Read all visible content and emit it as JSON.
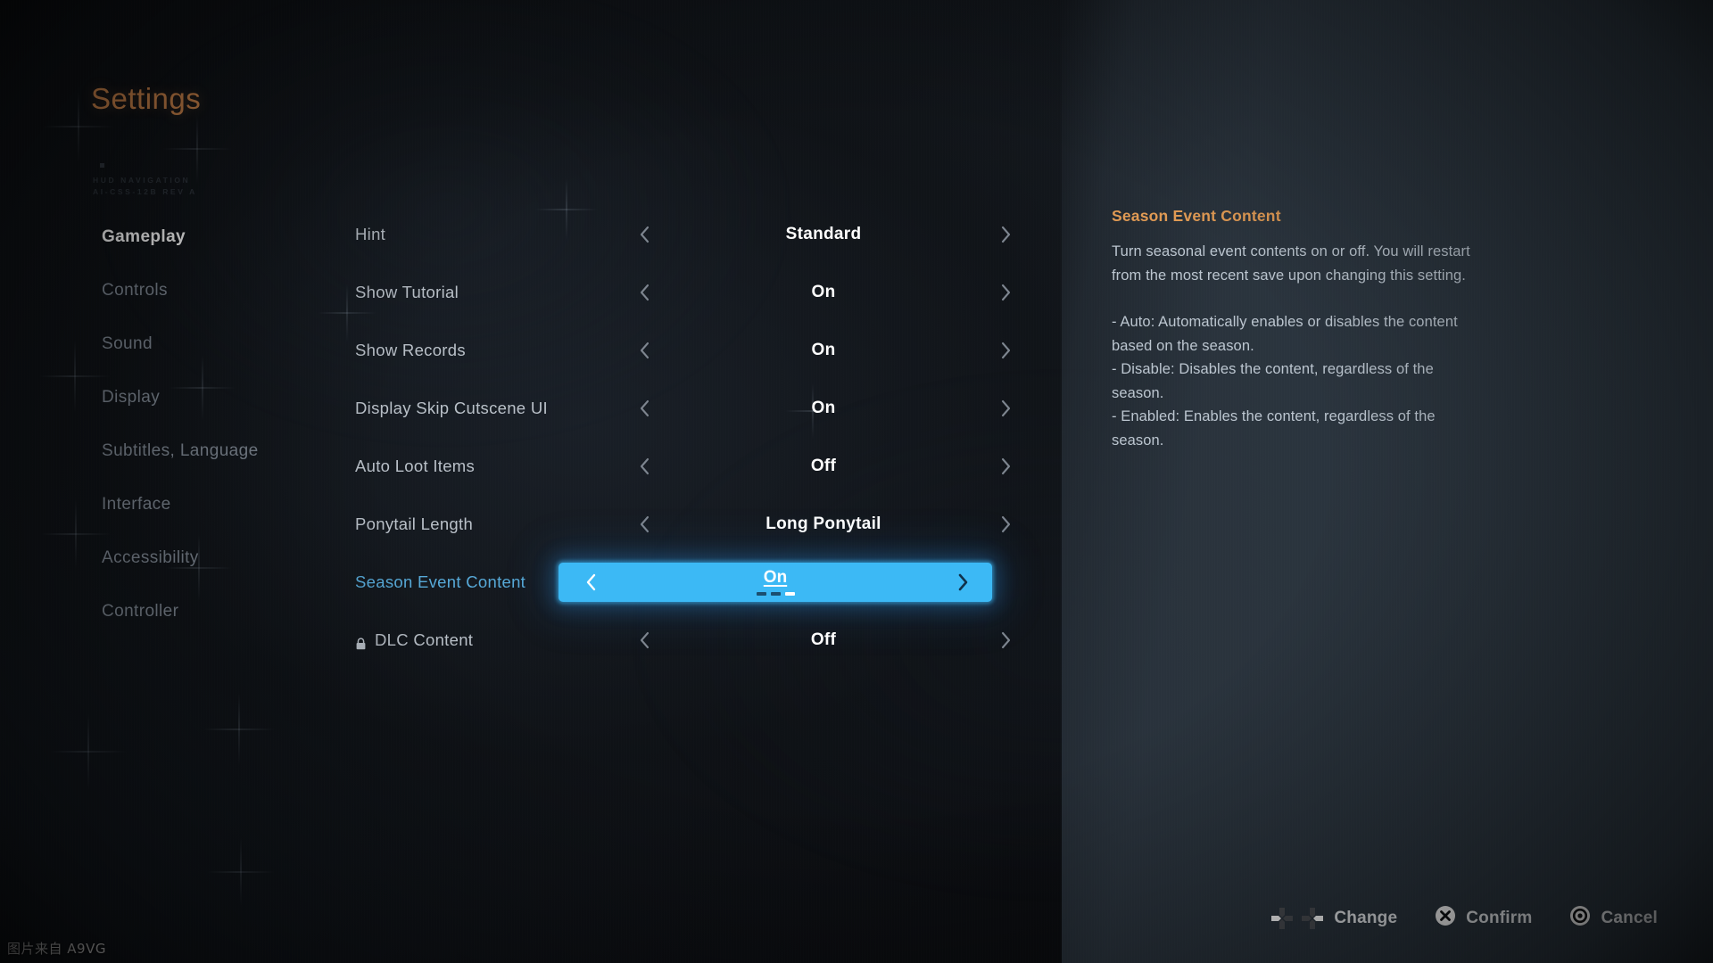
{
  "header": {
    "title": "Settings",
    "hud_stamp_line1": "HUD NAVIGATION",
    "hud_stamp_line2": "AI-CSS-12B REV A"
  },
  "sidebar": {
    "items": [
      {
        "label": "Gameplay",
        "active": true
      },
      {
        "label": "Controls",
        "active": false
      },
      {
        "label": "Sound",
        "active": false
      },
      {
        "label": "Display",
        "active": false
      },
      {
        "label": "Subtitles, Language",
        "active": false
      },
      {
        "label": "Interface",
        "active": false
      },
      {
        "label": "Accessibility",
        "active": false
      },
      {
        "label": "Controller",
        "active": false
      }
    ]
  },
  "settings": {
    "rows": [
      {
        "label": "Hint",
        "value": "Standard",
        "selected": false,
        "locked": false
      },
      {
        "label": "Show Tutorial",
        "value": "On",
        "selected": false,
        "locked": false
      },
      {
        "label": "Show Records",
        "value": "On",
        "selected": false,
        "locked": false
      },
      {
        "label": "Display Skip Cutscene UI",
        "value": "On",
        "selected": false,
        "locked": false
      },
      {
        "label": "Auto Loot Items",
        "value": "Off",
        "selected": false,
        "locked": false
      },
      {
        "label": "Ponytail Length",
        "value": "Long Ponytail",
        "selected": false,
        "locked": false
      },
      {
        "label": "Season Event Content",
        "value": "On",
        "selected": true,
        "locked": false,
        "option_index": 3,
        "option_count": 3
      },
      {
        "label": "DLC Content",
        "value": "Off",
        "selected": false,
        "locked": true
      }
    ]
  },
  "description": {
    "title": "Season Event Content",
    "paragraph": "Turn seasonal event contents on or off. You will restart from the most recent save upon changing this setting.",
    "bullets": [
      "- Auto: Automatically enables or disables the content based on the season.",
      "- Disable: Disables the content, regardless of the season.",
      "- Enabled: Enables the content, regardless of the season."
    ]
  },
  "prompts": [
    {
      "label": "Change",
      "icon": "dpad-updown-leftright-icon"
    },
    {
      "label": "Confirm",
      "icon": "cross-button-icon"
    },
    {
      "label": "Cancel",
      "icon": "circle-button-icon"
    }
  ],
  "watermark": "图片来自 A9VG",
  "colors": {
    "accent_orange": "#d68a4e",
    "highlight_blue": "#3cb9f5",
    "selected_label_blue": "#57a9d8",
    "panel_slate": "#2c3640"
  }
}
